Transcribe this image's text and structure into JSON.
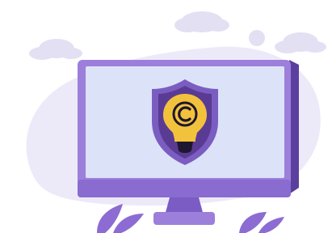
{
  "illustration": {
    "subject": "copyright-protection",
    "icons": [
      "monitor-icon",
      "shield-icon",
      "lightbulb-icon",
      "copyright-icon",
      "cloud-icon",
      "leaf-icon"
    ]
  },
  "colors": {
    "background": "#ffffff",
    "blob": "#ECEAF8",
    "cloud": "#E3E0F3",
    "monitor_frame": "#9C7FDB",
    "monitor_frame_dark": "#7A5CC4",
    "monitor_frame_side": "#5B3F9E",
    "screen": "#DCE3F8",
    "stand": "#8A6BD0",
    "shield_outer": "#7B5DC2",
    "shield_inner": "#5A3B93",
    "bulb": "#F3C23C",
    "bulb_base": "#1E1730",
    "copyright_mark": "#1E1730",
    "leaves": "#8C6CD3"
  }
}
